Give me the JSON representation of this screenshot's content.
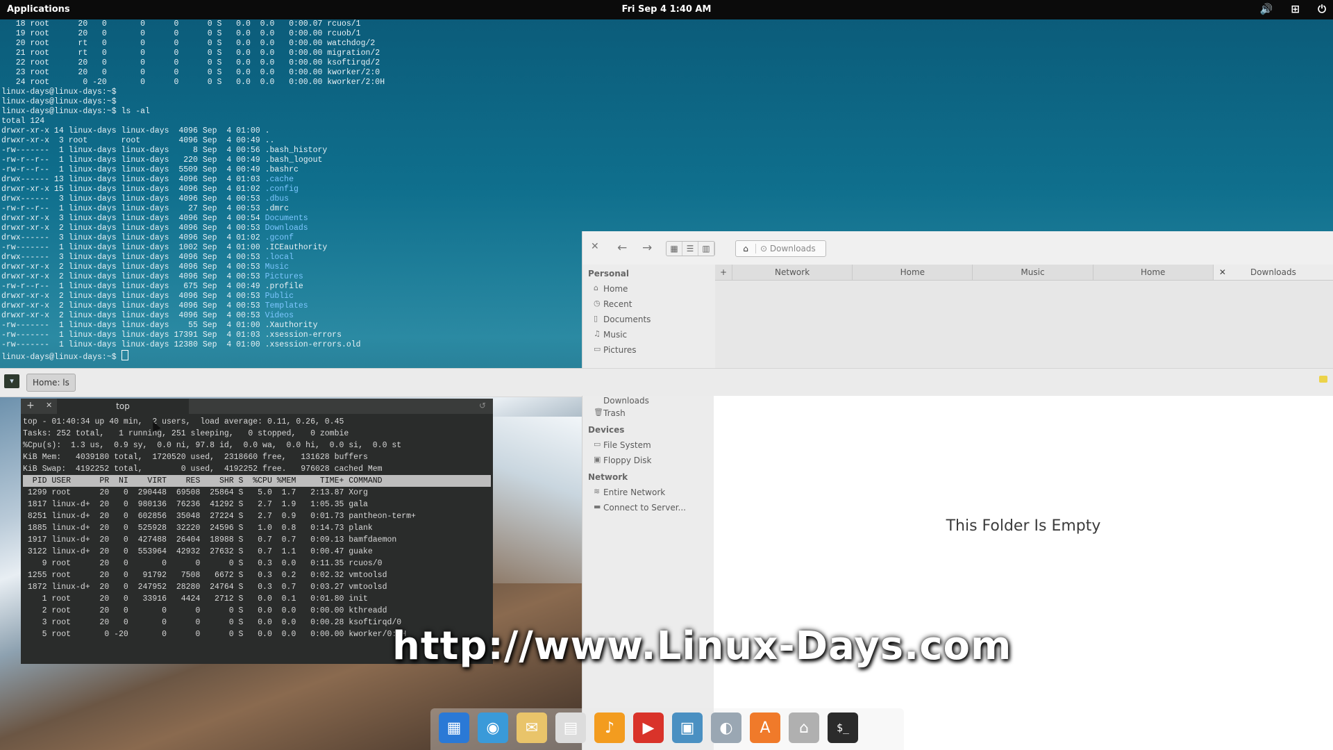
{
  "top_panel": {
    "applications": "Applications",
    "clock": "Fri Sep 4   1:40 AM",
    "tray_icons": [
      "volume-icon",
      "network-icon",
      "power-icon"
    ]
  },
  "terminal_top": {
    "lines": [
      "   18 root      20   0       0      0      0 S   0.0  0.0   0:00.07 rcuos/1",
      "   19 root      20   0       0      0      0 S   0.0  0.0   0:00.00 rcuob/1",
      "   20 root      rt   0       0      0      0 S   0.0  0.0   0:00.00 watchdog/2",
      "   21 root      rt   0       0      0      0 S   0.0  0.0   0:00.00 migration/2",
      "   22 root      20   0       0      0      0 S   0.0  0.0   0:00.00 ksoftirqd/2",
      "   23 root      20   0       0      0      0 S   0.0  0.0   0:00.00 kworker/2:0",
      "   24 root       0 -20       0      0      0 S   0.0  0.0   0:00.00 kworker/2:0H",
      "linux-days@linux-days:~$",
      "linux-days@linux-days:~$",
      "linux-days@linux-days:~$ ls -al",
      "total 124"
    ],
    "listing": [
      {
        "meta": "drwxr-xr-x 14 linux-days linux-days  4096 Sep  4 01:00 ",
        "name": ".",
        "dir": true
      },
      {
        "meta": "drwxr-xr-x  3 root       root        4096 Sep  4 00:49 ",
        "name": "..",
        "dir": true
      },
      {
        "meta": "-rw-------  1 linux-days linux-days     8 Sep  4 00:56 ",
        "name": ".bash_history",
        "dir": false
      },
      {
        "meta": "-rw-r--r--  1 linux-days linux-days   220 Sep  4 00:49 ",
        "name": ".bash_logout",
        "dir": false
      },
      {
        "meta": "-rw-r--r--  1 linux-days linux-days  5509 Sep  4 00:49 ",
        "name": ".bashrc",
        "dir": false
      },
      {
        "meta": "drwx------ 13 linux-days linux-days  4096 Sep  4 01:03 ",
        "name": ".cache",
        "dir": true
      },
      {
        "meta": "drwxr-xr-x 15 linux-days linux-days  4096 Sep  4 01:02 ",
        "name": ".config",
        "dir": true
      },
      {
        "meta": "drwx------  3 linux-days linux-days  4096 Sep  4 00:53 ",
        "name": ".dbus",
        "dir": true
      },
      {
        "meta": "-rw-r--r--  1 linux-days linux-days    27 Sep  4 00:53 ",
        "name": ".dmrc",
        "dir": false
      },
      {
        "meta": "drwxr-xr-x  3 linux-days linux-days  4096 Sep  4 00:54 ",
        "name": "Documents",
        "dir": true
      },
      {
        "meta": "drwxr-xr-x  2 linux-days linux-days  4096 Sep  4 00:53 ",
        "name": "Downloads",
        "dir": true
      },
      {
        "meta": "drwx------  3 linux-days linux-days  4096 Sep  4 01:02 ",
        "name": ".gconf",
        "dir": true
      },
      {
        "meta": "-rw-------  1 linux-days linux-days  1002 Sep  4 01:00 ",
        "name": ".ICEauthority",
        "dir": false
      },
      {
        "meta": "drwx------  3 linux-days linux-days  4096 Sep  4 00:53 ",
        "name": ".local",
        "dir": true
      },
      {
        "meta": "drwxr-xr-x  2 linux-days linux-days  4096 Sep  4 00:53 ",
        "name": "Music",
        "dir": true
      },
      {
        "meta": "drwxr-xr-x  2 linux-days linux-days  4096 Sep  4 00:53 ",
        "name": "Pictures",
        "dir": true
      },
      {
        "meta": "-rw-r--r--  1 linux-days linux-days   675 Sep  4 00:49 ",
        "name": ".profile",
        "dir": false
      },
      {
        "meta": "drwxr-xr-x  2 linux-days linux-days  4096 Sep  4 00:53 ",
        "name": "Public",
        "dir": true
      },
      {
        "meta": "drwxr-xr-x  2 linux-days linux-days  4096 Sep  4 00:53 ",
        "name": "Templates",
        "dir": true
      },
      {
        "meta": "drwxr-xr-x  2 linux-days linux-days  4096 Sep  4 00:53 ",
        "name": "Videos",
        "dir": true
      },
      {
        "meta": "-rw-------  1 linux-days linux-days    55 Sep  4 01:00 ",
        "name": ".Xauthority",
        "dir": false
      },
      {
        "meta": "-rw-------  1 linux-days linux-days 17391 Sep  4 01:03 ",
        "name": ".xsession-errors",
        "dir": false
      },
      {
        "meta": "-rw-------  1 linux-days linux-days 12380 Sep  4 01:00 ",
        "name": ".xsession-errors.old",
        "dir": false
      }
    ],
    "prompt": "linux-days@linux-days:~$ "
  },
  "file_manager": {
    "breadcrumb": "Downloads",
    "sidebar": {
      "personal_heading": "Personal",
      "personal_items": [
        {
          "label": "Home",
          "icon": "home-icon"
        },
        {
          "label": "Recent",
          "icon": "clock-icon"
        },
        {
          "label": "Documents",
          "icon": "document-icon"
        },
        {
          "label": "Music",
          "icon": "music-icon"
        },
        {
          "label": "Pictures",
          "icon": "picture-icon"
        }
      ],
      "downloads_partial": "Downloads",
      "trash": "Trash",
      "devices_heading": "Devices",
      "devices": [
        "File System",
        "Floppy Disk"
      ],
      "network_heading": "Network",
      "network_items": [
        "Entire Network",
        "Connect to Server..."
      ]
    },
    "tabs": [
      "Network",
      "Home",
      "Music",
      "Home",
      "Downloads"
    ],
    "empty_message": "This Folder Is Empty"
  },
  "taskbar": {
    "window_button": "Home: ls"
  },
  "terminal_top_window": {
    "tab_label": "top",
    "header": [
      "top - 01:40:34 up 40 min,  2 users,  load average: 0.11, 0.26, 0.45",
      "Tasks: 252 total,   1 running, 251 sleeping,   0 stopped,   0 zombie",
      "%Cpu(s):  1.3 us,  0.9 sy,  0.0 ni, 97.8 id,  0.0 wa,  0.0 hi,  0.0 si,  0.0 st",
      "KiB Mem:   4039180 total,  1720520 used,  2318660 free,   131628 buffers",
      "KiB Swap:  4192252 total,        0 used,  4192252 free.   976028 cached Mem"
    ],
    "column_header": "  PID USER      PR  NI    VIRT    RES    SHR S  %CPU %MEM     TIME+ COMMAND      ",
    "processes": [
      " 1299 root      20   0  290448  69508  25864 S   5.0  1.7   2:13.87 Xorg",
      " 1817 linux-d+  20   0  980136  76236  41292 S   2.7  1.9   1:05.35 gala",
      " 8251 linux-d+  20   0  602856  35048  27224 S   2.7  0.9   0:01.73 pantheon-term+",
      " 1885 linux-d+  20   0  525928  32220  24596 S   1.0  0.8   0:14.73 plank",
      " 1917 linux-d+  20   0  427488  26404  18988 S   0.7  0.7   0:09.13 bamfdaemon",
      " 3122 linux-d+  20   0  553964  42932  27632 S   0.7  1.1   0:00.47 guake",
      "    9 root      20   0       0      0      0 S   0.3  0.0   0:11.35 rcuos/0",
      " 1255 root      20   0   91792   7508   6672 S   0.3  0.2   0:02.32 vmtoolsd",
      " 1872 linux-d+  20   0  247952  28280  24764 S   0.3  0.7   0:03.27 vmtoolsd",
      "    1 root      20   0   33916   4424   2712 S   0.0  0.1   0:01.80 init",
      "    2 root      20   0       0      0      0 S   0.0  0.0   0:00.00 kthreadd",
      "    3 root      20   0       0      0      0 S   0.0  0.0   0:00.28 ksoftirqd/0",
      "    5 root       0 -20       0      0      0 S   0.0  0.0   0:00.00 kworker/0:0H"
    ]
  },
  "watermark": "http://www.Linux-Days.com",
  "dock": {
    "apps": [
      {
        "icon": "multitasking-icon",
        "color": "#2a79d6",
        "glyph": "▦"
      },
      {
        "icon": "browser-icon",
        "color": "#3a9ad9",
        "glyph": "◉"
      },
      {
        "icon": "mail-icon",
        "color": "#e9c46a",
        "glyph": "✉"
      },
      {
        "icon": "calendar-icon",
        "color": "#dcdcdc",
        "glyph": "▤"
      },
      {
        "icon": "music-player-icon",
        "color": "#f39c1f",
        "glyph": "♪"
      },
      {
        "icon": "video-player-icon",
        "color": "#d9332a",
        "glyph": "▶"
      },
      {
        "icon": "photos-icon",
        "color": "#4a90c2",
        "glyph": "▣"
      },
      {
        "icon": "settings-icon",
        "color": "#9aa7b3",
        "glyph": "◐"
      },
      {
        "icon": "app-center-icon",
        "color": "#f07a2a",
        "glyph": "A"
      },
      {
        "icon": "files-icon",
        "color": "#b0b0b0",
        "glyph": "⌂"
      },
      {
        "icon": "terminal-icon",
        "color": "#2b2b2b",
        "glyph": "$_"
      }
    ]
  }
}
